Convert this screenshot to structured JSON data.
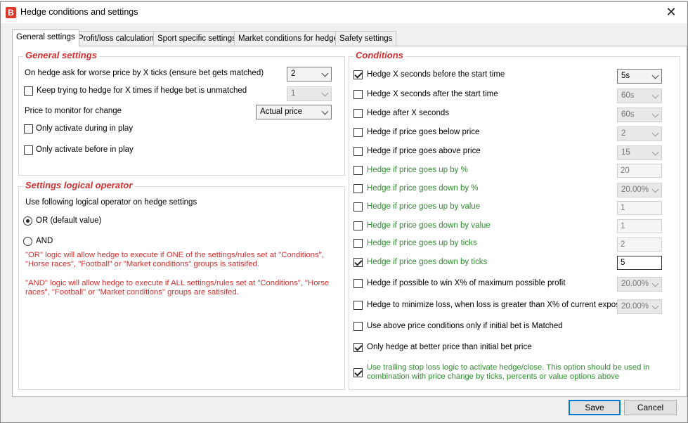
{
  "window": {
    "title": "Hedge conditions and settings",
    "app_icon_letter": "B"
  },
  "tabs": [
    "General settings",
    "Profit/loss calculation",
    "Sport specific settings",
    "Market conditions for hedge",
    "Safety settings"
  ],
  "general": {
    "title": "General settings",
    "worse_price_label": "On hedge ask for worse price by X ticks (ensure bet gets matched)",
    "worse_price_value": "2",
    "keep_trying_label": "Keep trying to hedge for X times if hedge bet is unmatched",
    "keep_trying_value": "1",
    "monitor_label": "Price to monitor for change",
    "monitor_value": "Actual price",
    "inplay_label": "Only activate during in play",
    "before_inplay_label": "Only activate before in play"
  },
  "logic": {
    "title": "Settings logical operator",
    "desc": "Use following logical operator on hedge settings",
    "or_label": "OR (default value)",
    "and_label": "AND",
    "or_text": "\"OR\" logic will allow hedge to execute if ONE of the settings/rules set at \"Conditions\", \"Horse races\", \"Football\" or \"Market conditions\" groups is satisifed.",
    "and_text": "\"AND\" logic will allow hedge to execute if ALL settings/rules set at \"Conditions\", \"Horse races\", \"Football\" or \"Market conditions\" groups are satisifed."
  },
  "conditions": {
    "title": "Conditions",
    "rows": [
      {
        "label": "Hedge X seconds before the start time",
        "value": "5s"
      },
      {
        "label": "Hedge X seconds after the start time",
        "value": "60s"
      },
      {
        "label": "Hedge after X seconds",
        "value": "60s"
      },
      {
        "label": "Hedge if price goes below price",
        "value": "2"
      },
      {
        "label": "Hedge if price goes above price",
        "value": "15"
      },
      {
        "label": "Hedge if price goes up by %",
        "value": "20"
      },
      {
        "label": "Hedge if price goes down by %",
        "value": "20.00%"
      },
      {
        "label": "Hedge if price goes up by value",
        "value": "1"
      },
      {
        "label": "Hedge if price goes down by value",
        "value": "1"
      },
      {
        "label": "Hedge if price goes up by ticks",
        "value": "2"
      },
      {
        "label": "Hedge if price goes down by ticks",
        "value": "5"
      },
      {
        "label": "Hedge if possible to win X% of maximum possible profit",
        "value": "20.00%"
      },
      {
        "label": "Hedge to minimize loss, when loss is greater than X% of current exposure",
        "value": "20.00%"
      },
      {
        "label": "Use above price conditions only if initial bet is Matched"
      },
      {
        "label": "Only hedge at better price than initial bet price"
      },
      {
        "label": "Use trailing stop loss logic to activate hedge/close. This option should be used in",
        "label2": "combination with price change by ticks, percents or value options above"
      }
    ]
  },
  "buttons": {
    "save": "Save",
    "cancel": "Cancel"
  },
  "colors": {
    "accent_red": "#d32f2f",
    "label_green": "#2e8b2e",
    "focus_blue": "#0078d7"
  }
}
